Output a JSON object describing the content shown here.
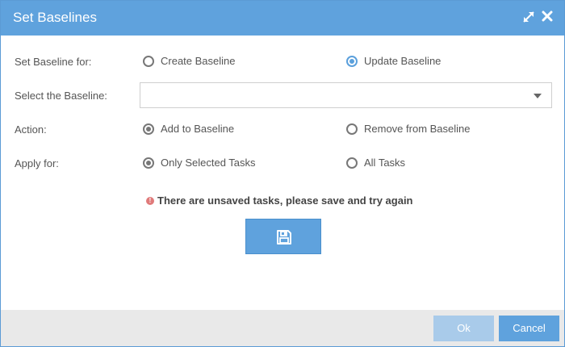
{
  "dialog": {
    "title": "Set Baselines",
    "icons": [
      "expand-icon",
      "close-icon"
    ]
  },
  "form": {
    "baseline_for": {
      "label": "Set Baseline for:",
      "options": [
        {
          "label": "Create Baseline",
          "checked": false
        },
        {
          "label": "Update Baseline",
          "checked": true
        }
      ]
    },
    "select_baseline": {
      "label": "Select the Baseline:",
      "value": ""
    },
    "action": {
      "label": "Action:",
      "options": [
        {
          "label": "Add to Baseline",
          "checked": true
        },
        {
          "label": "Remove from Baseline",
          "checked": false
        }
      ]
    },
    "apply_for": {
      "label": "Apply for:",
      "options": [
        {
          "label": "Only Selected Tasks",
          "checked": true
        },
        {
          "label": "All Tasks",
          "checked": false
        }
      ]
    }
  },
  "warning": {
    "icon": "exclamation-circle-icon",
    "text": "There are unsaved tasks, please save and try again"
  },
  "save_button": {
    "icon": "floppy-disk-icon"
  },
  "footer": {
    "ok_label": "Ok",
    "cancel_label": "Cancel"
  },
  "colors": {
    "header": "#5fa2dd",
    "accent": "#5ba0dc",
    "ok_disabled": "#a9cbea",
    "warning": "#e07a7a",
    "footer_bg": "#e9e9e9"
  }
}
